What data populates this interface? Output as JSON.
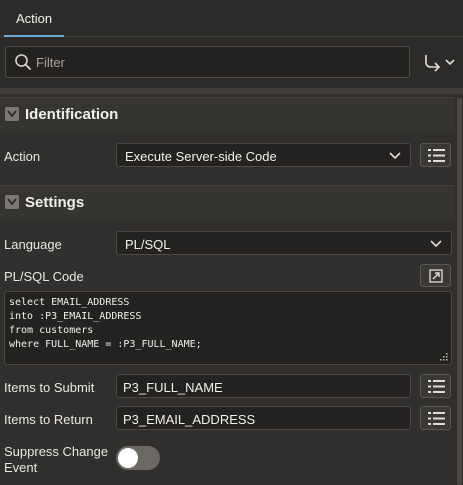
{
  "tabs": [
    {
      "label": "Action"
    }
  ],
  "filter": {
    "placeholder": "Filter"
  },
  "identification": {
    "title": "Identification",
    "action_label": "Action",
    "action_value": "Execute Server-side Code"
  },
  "settings": {
    "title": "Settings",
    "language_label": "Language",
    "language_value": "PL/SQL",
    "code_label": "PL/SQL Code",
    "code_lines": [
      "select EMAIL_ADDRESS",
      "into :P3_EMAIL_ADDRESS",
      "from customers",
      "where FULL_NAME = :P3_FULL_NAME;"
    ],
    "submit_label": "Items to Submit",
    "submit_value": "P3_FULL_NAME",
    "return_label": "Items to Return",
    "return_value": "P3_EMAIL_ADDRESS",
    "suppress_label_line1": "Suppress Change",
    "suppress_label_line2": "Event",
    "suppress_on": false
  },
  "icons": {
    "search": "search-icon",
    "goto": "goto-arrow-icon",
    "collapse": "chevron-down-icon",
    "list": "list-picker-icon",
    "expand": "expand-icon",
    "resize": "resize-grip-icon"
  },
  "colors": {
    "accent": "#6aa7d4",
    "background": "#312f2d",
    "field": "#242220"
  }
}
